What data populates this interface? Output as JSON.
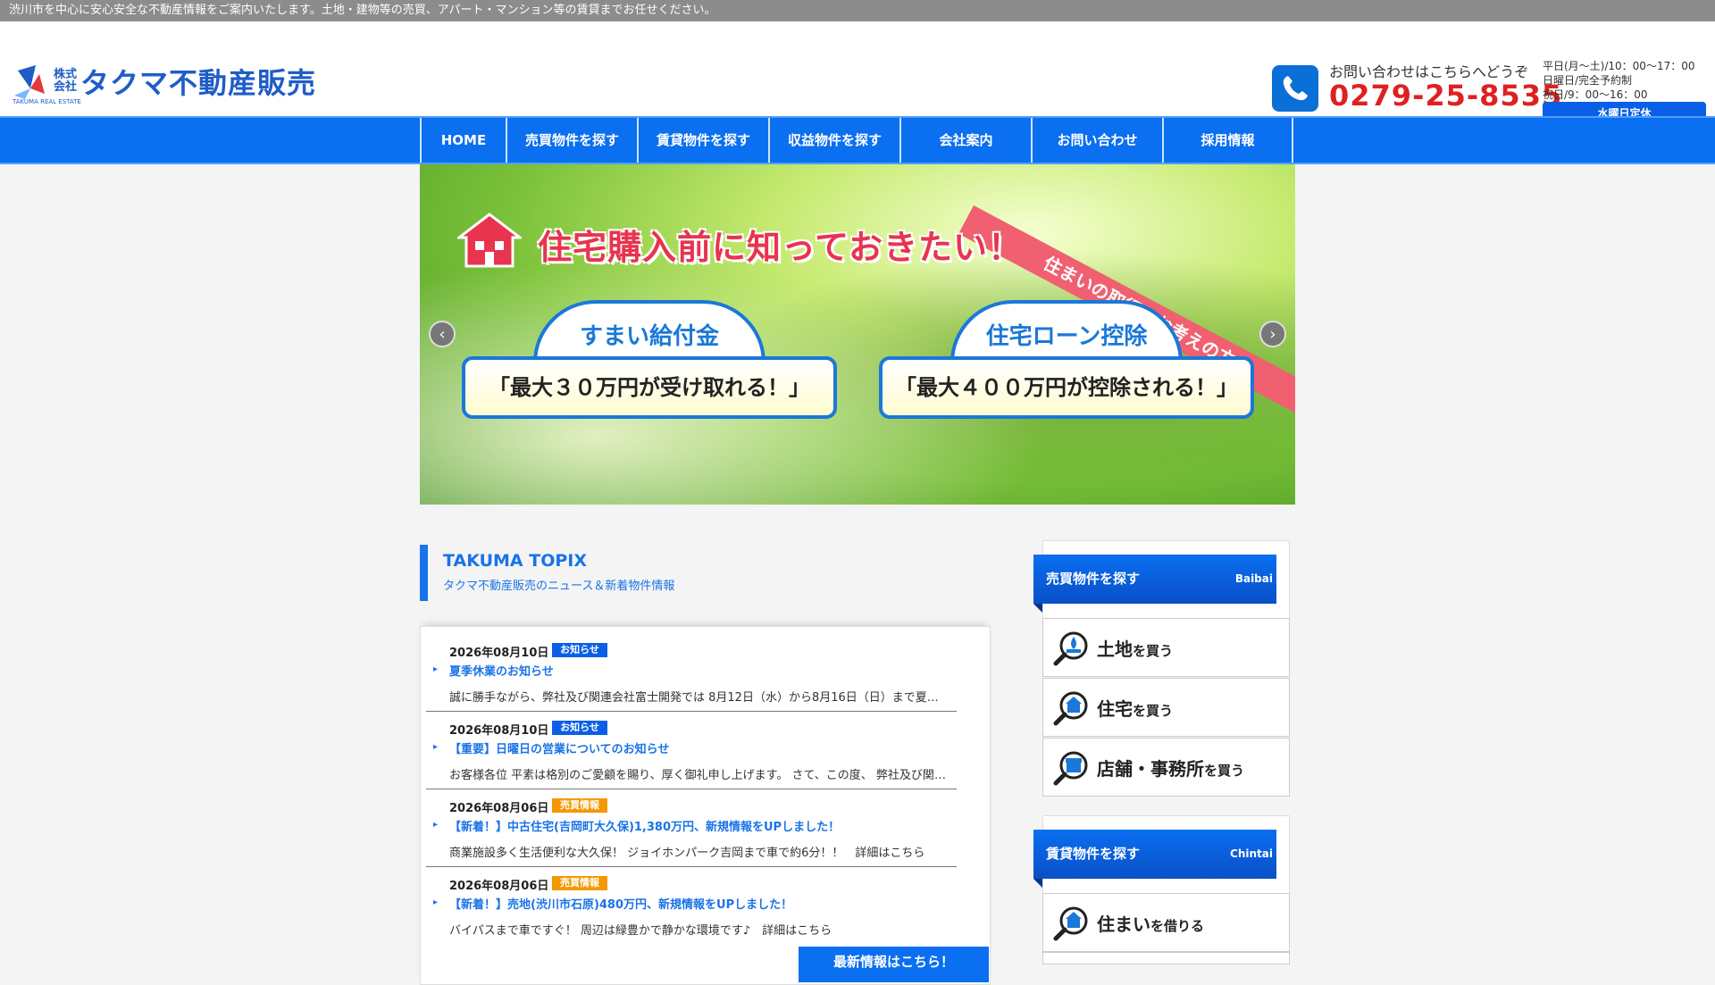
{
  "topbar": {
    "text": "渋川市を中心に安心安全な不動産情報をご案内いたします。土地・建物等の売買、アパート・マンション等の賃貸までお任せください。"
  },
  "logo": {
    "kabu_top": "株式",
    "kabu_bottom": "会社",
    "name": "タクマ不動産販売",
    "sub": "TAKUMA REAL ESTATE"
  },
  "contact": {
    "lead": "お問い合わせはこちらへどうぞ",
    "tel": "0279-25-8535",
    "hours": [
      "平日(月～土)/10：00～17：00",
      "日曜日/完全予約制",
      "祝日/9：00～16：00"
    ],
    "closed": "水曜日定休"
  },
  "nav": [
    {
      "label": "HOME",
      "width": 96
    },
    {
      "label": "売買物件を探す",
      "width": 147
    },
    {
      "label": "賃貸物件を探す",
      "width": 147
    },
    {
      "label": "収益物件を探す",
      "width": 147
    },
    {
      "label": "会社案内",
      "width": 147
    },
    {
      "label": "お問い合わせ",
      "width": 147
    },
    {
      "label": "採用情報",
      "width": 147
    }
  ],
  "hero": {
    "title": "住宅購入前に知っておきたい！",
    "ribbon": "住まいの取得をお考えの方へ",
    "bubble1_title": "すまい給付金",
    "bubble1_body": "「最大３０万円が受け取れる！」",
    "bubble2_title": "住宅ローン控除",
    "bubble2_body": "「最大４００万円が控除される！」",
    "prev": "‹",
    "next": "›"
  },
  "topix": {
    "title": "TAKUMA TOPIX",
    "subtitle": "タクマ不動産販売のニュース＆新着物件情報"
  },
  "news": [
    {
      "date": "2026年08月10日",
      "badge": "お知らせ",
      "color": "blue",
      "title": "夏季休業のお知らせ",
      "body": "誠に勝手ながら、弊社及び関連会社富士開発では 8月12日（水）から8月16日（日）まで夏季休業とさせていただきます。"
    },
    {
      "date": "2026年08月10日",
      "badge": "お知らせ",
      "color": "blue",
      "title": "【重要】日曜日の営業についてのお知らせ",
      "body": "お客様各位 平素は格別のご愛顧を賜り、厚く御礼申し上げます。 さて、この度、 弊社及び関連会社では日曜日の営業を"
    },
    {
      "date": "2026年08月06日",
      "badge": "売買情報",
      "color": "orange",
      "title": "【新着！】中古住宅(吉岡町大久保)1,380万円、新規情報をUPしました！",
      "body": "商業施設多く生活便利な大久保！ ジョイホンパーク吉岡まで車で約6分！！　詳細はこちら"
    },
    {
      "date": "2026年08月06日",
      "badge": "売買情報",
      "color": "orange",
      "title": "【新着！】売地(渋川市石原)480万円、新規情報をUPしました！",
      "body": "バイパスまで車ですぐ！ 周辺は緑豊かで静かな環境です♪　詳細はこちら"
    }
  ],
  "more_button": "最新情報はこちら！",
  "sidebar": {
    "buy_head": {
      "jp": "売買物件を探す",
      "en": "Baibai"
    },
    "buy_items": [
      {
        "main": "土地",
        "suffix": "を買う"
      },
      {
        "main": "住宅",
        "suffix": "を買う"
      },
      {
        "main": "店舗・事務所",
        "suffix": "を買う"
      }
    ],
    "rent_head": {
      "jp": "賃貸物件を探す",
      "en": "Chintai"
    },
    "rent_items": [
      {
        "main": "住まい",
        "suffix": "を借りる"
      }
    ]
  }
}
